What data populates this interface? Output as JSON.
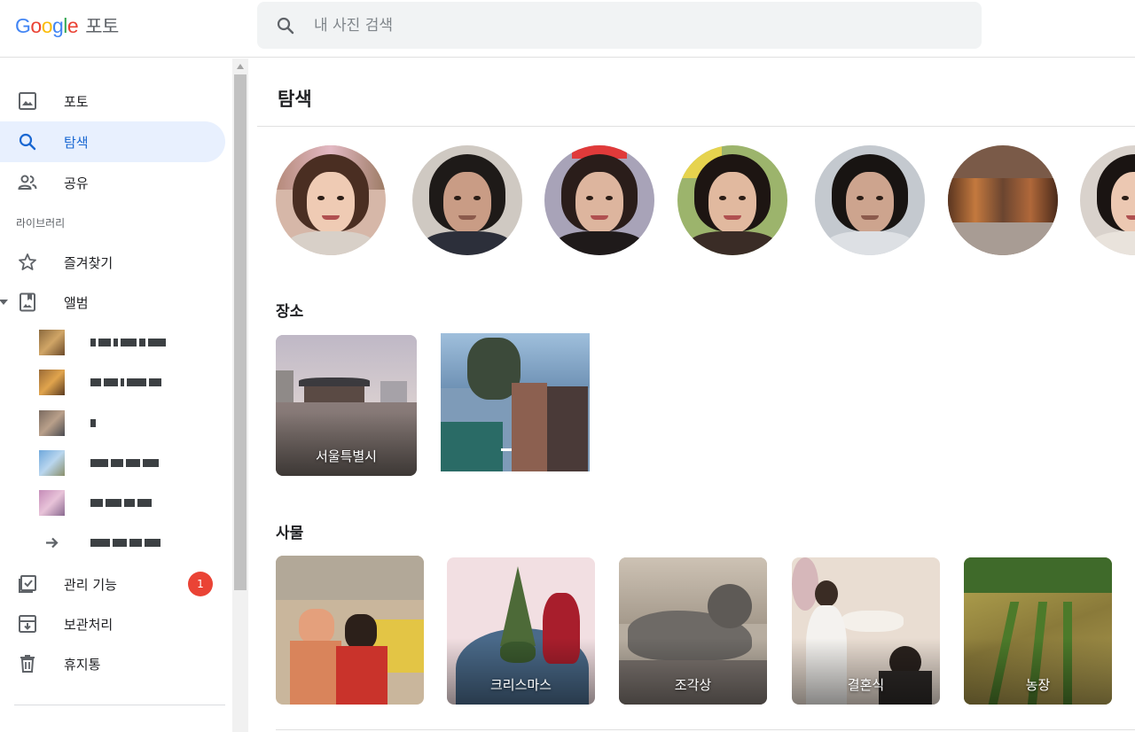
{
  "header": {
    "logo_google": "Google",
    "logo_product": "포토",
    "search_placeholder": "내 사진 검색",
    "icons": {
      "search": "search-icon"
    }
  },
  "sidebar": {
    "nav": [
      {
        "label": "포토",
        "icon": "photo-icon",
        "active": false
      },
      {
        "label": "탐색",
        "icon": "search-icon",
        "active": true
      },
      {
        "label": "공유",
        "icon": "people-icon",
        "active": false
      }
    ],
    "library_label": "라이브러리",
    "library": [
      {
        "label": "즐겨찾기",
        "icon": "star-icon"
      },
      {
        "label": "앨범",
        "icon": "album-icon"
      }
    ],
    "albums_count": 6,
    "utilities": [
      {
        "label": "관리 기능",
        "icon": "checklist-icon",
        "badge": "1"
      },
      {
        "label": "보관처리",
        "icon": "archive-icon"
      },
      {
        "label": "휴지통",
        "icon": "trash-icon"
      }
    ]
  },
  "main": {
    "title": "탐색",
    "people_count": 7,
    "places_title": "장소",
    "places": [
      {
        "caption": "서울특별시"
      },
      {
        "caption": ""
      }
    ],
    "things_title": "사물",
    "things": [
      {
        "caption": ""
      },
      {
        "caption": "크리스마스"
      },
      {
        "caption": "조각상"
      },
      {
        "caption": "결혼식"
      },
      {
        "caption": "농장"
      }
    ]
  },
  "colors": {
    "accent": "#1967d2",
    "active_bg": "#e8f0fe",
    "badge": "#ea4335",
    "search_bg": "#f1f3f4"
  }
}
